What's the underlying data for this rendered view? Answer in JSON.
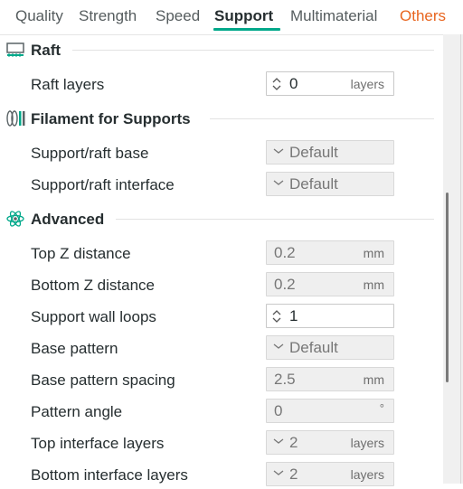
{
  "tabs": [
    {
      "label": "Quality"
    },
    {
      "label": "Strength"
    },
    {
      "label": "Speed"
    },
    {
      "label": "Support"
    },
    {
      "label": "Multimaterial"
    },
    {
      "label": "Others"
    }
  ],
  "colors": {
    "accent": "#00a88a",
    "others_tab": "#e8651f"
  },
  "sections": {
    "raft": {
      "title": "Raft",
      "icon": "raft-icon"
    },
    "filament": {
      "title": "Filament for Supports",
      "icon": "filament-icon"
    },
    "advanced": {
      "title": "Advanced",
      "icon": "atom-icon"
    }
  },
  "rows": {
    "raft_layers": {
      "label": "Raft layers",
      "value": "0",
      "unit": "layers"
    },
    "support_raft_base": {
      "label": "Support/raft base",
      "value": "Default"
    },
    "support_raft_interface": {
      "label": "Support/raft interface",
      "value": "Default"
    },
    "top_z_distance": {
      "label": "Top Z distance",
      "value": "0.2",
      "unit": "mm"
    },
    "bottom_z_distance": {
      "label": "Bottom Z distance",
      "value": "0.2",
      "unit": "mm"
    },
    "support_wall_loops": {
      "label": "Support wall loops",
      "value": "1"
    },
    "base_pattern": {
      "label": "Base pattern",
      "value": "Default"
    },
    "base_pattern_spacing": {
      "label": "Base pattern spacing",
      "value": "2.5",
      "unit": "mm"
    },
    "pattern_angle": {
      "label": "Pattern angle",
      "value": "0",
      "unit": "°"
    },
    "top_interface_layers": {
      "label": "Top interface layers",
      "value": "2",
      "unit": "layers"
    },
    "bottom_interface_layers": {
      "label": "Bottom interface layers",
      "value": "2",
      "unit": "layers"
    }
  }
}
